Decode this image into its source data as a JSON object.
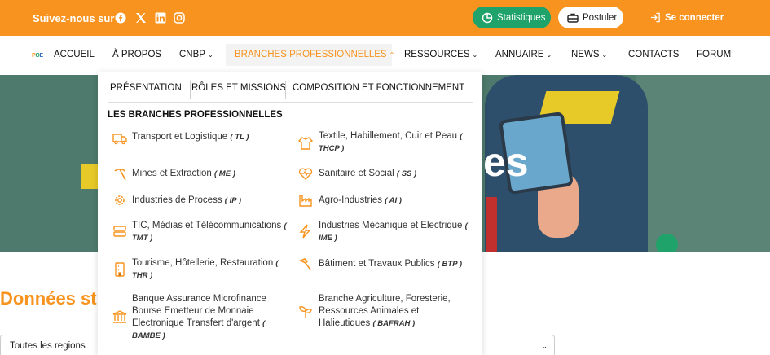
{
  "topbar": {
    "follow_label": "Suivez-nous sur :",
    "social": [
      "facebook-icon",
      "x-icon",
      "linkedin-icon",
      "instagram-icon"
    ],
    "stats_label": "Statistiques",
    "apply_label": "Postuler",
    "login_label": "Se connecter"
  },
  "nav": {
    "logo": [
      "P",
      "O",
      "E"
    ],
    "items": [
      "ACCUEIL",
      "À PROPOS",
      "CNBP",
      "BRANCHES PROFESSIONNELLES",
      "RESSOURCES",
      "ANNUAIRE",
      "NEWS",
      "CONTACTS",
      "FORUM"
    ]
  },
  "hero": {
    "partial_text": "es"
  },
  "dropdown": {
    "tabs": [
      "PRÉSENTATION",
      "RÔLES ET MISSIONS",
      "COMPOSITION ET FONCTIONNEMENT"
    ],
    "heading": "LES BRANCHES PROFESSIONNELLES",
    "branches": [
      {
        "label": "Transport et Logistique",
        "code": "( TL )",
        "icon": "truck-icon"
      },
      {
        "label": "Textile, Habillement, Cuir et Peau",
        "code": "( THCP )",
        "icon": "shirt-icon"
      },
      {
        "label": "Mines et Extraction",
        "code": "( ME )",
        "icon": "pickaxe-icon"
      },
      {
        "label": "Sanitaire et Social",
        "code": "( SS )",
        "icon": "heart-pulse-icon"
      },
      {
        "label": "Industries de Process",
        "code": "( IP )",
        "icon": "gear-icon"
      },
      {
        "label": "Agro-Industries",
        "code": "( AI )",
        "icon": "factory-icon"
      },
      {
        "label": "TIC, Médias et Télécommunications",
        "code": "( TMT )",
        "icon": "server-icon"
      },
      {
        "label": "Industries Mécanique et Electrique",
        "code": "( IME )",
        "icon": "lightning-icon"
      },
      {
        "label": "Tourisme, Hôtellerie, Restauration",
        "code": "( THR )",
        "icon": "hotel-icon"
      },
      {
        "label": "Bâtiment et Travaux Publics",
        "code": "( BTP )",
        "icon": "hammer-icon"
      },
      {
        "label": "Banque Assurance Microfinance Bourse Emetteur de Monnaie Electronique Transfert d'argent",
        "code": "( BAMBE )",
        "icon": "bank-icon"
      },
      {
        "label": "Branche Agriculture, Foresterie, Ressources Animales et Halieutiques",
        "code": "( BAFRAH )",
        "icon": "plant-icon"
      }
    ]
  },
  "stats_section": {
    "title": "Données st",
    "region_select": "Toutes les regions"
  },
  "colors": {
    "accent": "#f7931e",
    "green": "#1fa36b"
  }
}
